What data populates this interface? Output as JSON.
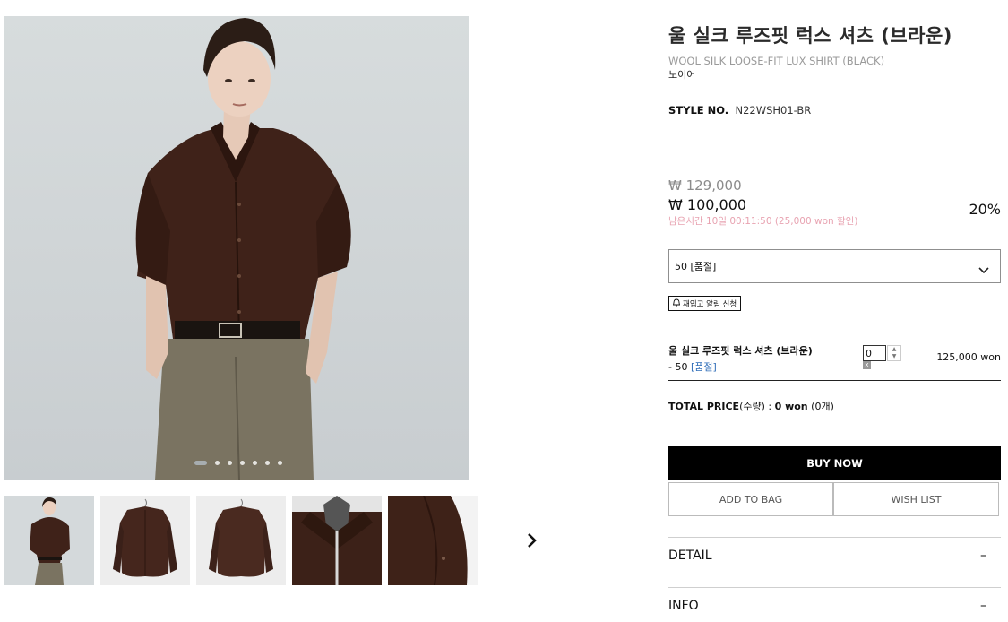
{
  "gallery": {
    "dot_count": 7,
    "active_dot": 0,
    "thumbnails": [
      "model-front",
      "shirt-on-hanger-front",
      "shirt-on-hanger-back",
      "collar-detail",
      "cuff-detail"
    ]
  },
  "product": {
    "title_ko": "울 실크 루즈핏 럭스 셔츠 (브라운)",
    "title_en": "WOOL SILK LOOSE-FIT LUX SHIRT (BLACK)",
    "brand": "노이어",
    "style_label": "STYLE NO.",
    "style_value": "N22WSH01-BR",
    "original_price": "₩ 129,000",
    "sale_price": "₩ 100,000",
    "timer_text": "남은시간 10일 00:11:50 (25,000 won 할인)",
    "discount": "20%"
  },
  "option": {
    "selected": "50 [품절]"
  },
  "restock": {
    "label": "재입고 알림 신청"
  },
  "cart_item": {
    "name": "울 실크 루즈핏 럭스 셔츠 (브라운)",
    "option_prefix": "- 50",
    "option_status": "[품절]",
    "quantity": "0",
    "price": "125,000 won",
    "remove": "x"
  },
  "total": {
    "label": "TOTAL PRICE",
    "qty_label": "(수량) : ",
    "amount": "0 won",
    "count": "(0개)"
  },
  "actions": {
    "buy_now": "BUY NOW",
    "add_to_bag": "ADD TO BAG",
    "wish_list": "WISH LIST"
  },
  "accordion": {
    "detail": "DETAIL",
    "info": "INFO",
    "toggle": "–"
  },
  "colors": {
    "shirt": "#3f2219",
    "trousers": "#7a7361",
    "background": "#d2d7d9",
    "timer": "#e8a3b1",
    "soldout_link": "#2f6db8",
    "buy_bg": "#000000"
  }
}
